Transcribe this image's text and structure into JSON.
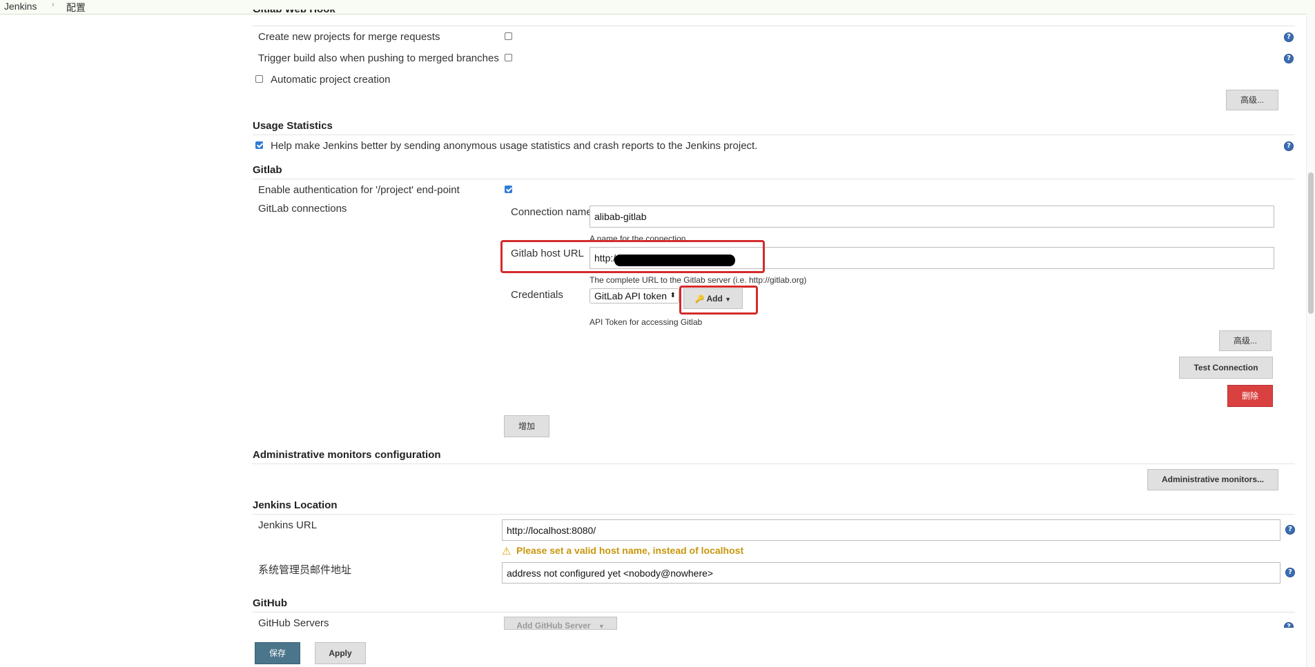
{
  "breadcrumb": {
    "root": "Jenkins",
    "sep": "›",
    "current": "配置"
  },
  "gitlab_webhook": {
    "title": "Gitlab Web Hook",
    "create_projects_label": "Create new projects for merge requests",
    "trigger_build_label": "Trigger build also when pushing to merged branches",
    "automatic_creation_label": "Automatic project creation",
    "advanced_button": "高级..."
  },
  "usage_stats": {
    "title": "Usage Statistics",
    "help_label": "Help make Jenkins better by sending anonymous usage statistics and crash reports to the Jenkins project."
  },
  "gitlab": {
    "title": "Gitlab",
    "enable_auth_label": "Enable authentication for '/project' end-point",
    "connections_label": "GitLab connections",
    "connection_name_label": "Connection name",
    "connection_name_value": "alibab-gitlab",
    "connection_name_hint": "A name for the connection",
    "host_url_label": "Gitlab host URL",
    "host_url_value": "http:/",
    "host_url_hint": "The complete URL to the Gitlab server (i.e. http://gitlab.org)",
    "credentials_label": "Credentials",
    "credentials_value": "GitLab API token",
    "add_button": "Add",
    "credentials_hint": "API Token for accessing Gitlab",
    "advanced_button": "高级...",
    "test_connection_button": "Test Connection",
    "delete_button": "删除",
    "add_connection_button": "增加"
  },
  "admin_monitors": {
    "title": "Administrative monitors configuration",
    "button": "Administrative monitors..."
  },
  "jenkins_location": {
    "title": "Jenkins Location",
    "url_label": "Jenkins URL",
    "url_value": "http://localhost:8080/",
    "warning": "Please set a valid host name, instead of localhost",
    "email_label": "系统管理员邮件地址",
    "email_value": "address not configured yet <nobody@nowhere>"
  },
  "github": {
    "title": "GitHub",
    "servers_label": "GitHub Servers",
    "add_server_button": "Add GitHub Server"
  },
  "footer": {
    "save_button": "保存",
    "apply_button": "Apply"
  },
  "colors": {
    "accent": "#2f7cd6",
    "danger": "#d94040",
    "highlight": "#d42a2a",
    "warning": "#c8960c",
    "save": "#4b758b"
  }
}
